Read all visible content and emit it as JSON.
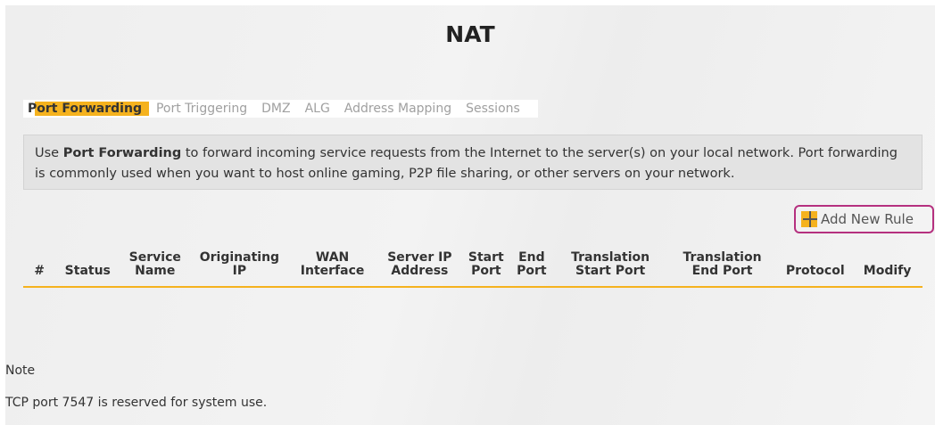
{
  "page": {
    "title": "NAT"
  },
  "tabs": [
    {
      "label": "Port Forwarding",
      "active": true
    },
    {
      "label": "Port Triggering",
      "active": false
    },
    {
      "label": "DMZ",
      "active": false
    },
    {
      "label": "ALG",
      "active": false
    },
    {
      "label": "Address Mapping",
      "active": false
    },
    {
      "label": "Sessions",
      "active": false
    }
  ],
  "info": {
    "prefix": "Use ",
    "bold": "Port Forwarding",
    "suffix": " to forward incoming service requests from the Internet to the server(s) on your local network. Port forwarding is commonly used when you want to host online gaming, P2P file sharing, or other servers on your network."
  },
  "add_rule": {
    "label": "Add New Rule",
    "icon": "plus-icon"
  },
  "table": {
    "columns": [
      {
        "line1": "#",
        "line2": ""
      },
      {
        "line1": "Status",
        "line2": ""
      },
      {
        "line1": "Service",
        "line2": "Name"
      },
      {
        "line1": "Originating",
        "line2": "IP"
      },
      {
        "line1": "WAN",
        "line2": "Interface"
      },
      {
        "line1": "Server IP",
        "line2": "Address"
      },
      {
        "line1": "Start",
        "line2": "Port"
      },
      {
        "line1": "End",
        "line2": "Port"
      },
      {
        "line1": "Translation",
        "line2": "Start Port"
      },
      {
        "line1": "Translation",
        "line2": "End Port"
      },
      {
        "line1": "Protocol",
        "line2": ""
      },
      {
        "line1": "Modify",
        "line2": ""
      }
    ],
    "rows": []
  },
  "note": {
    "title": "Note",
    "text": "TCP port 7547 is reserved for system use."
  },
  "colors": {
    "accent": "#f5b21e",
    "highlight_border": "#b5307f",
    "info_background": "#e3e3e3"
  }
}
